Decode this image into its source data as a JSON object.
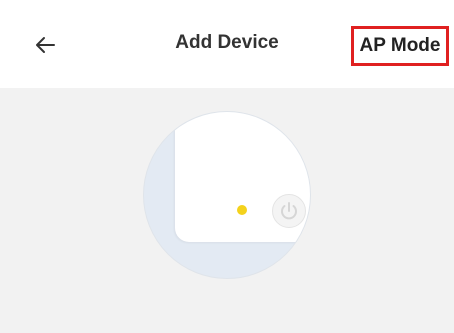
{
  "header": {
    "back_icon": "arrow-left-icon",
    "title": "Add Device",
    "mode_button": "AP Mode"
  },
  "illustration": {
    "led_color": "#f4d21c",
    "power_icon": "power-icon"
  },
  "colors": {
    "highlight": "#e02020",
    "background": "#f2f2f2"
  }
}
